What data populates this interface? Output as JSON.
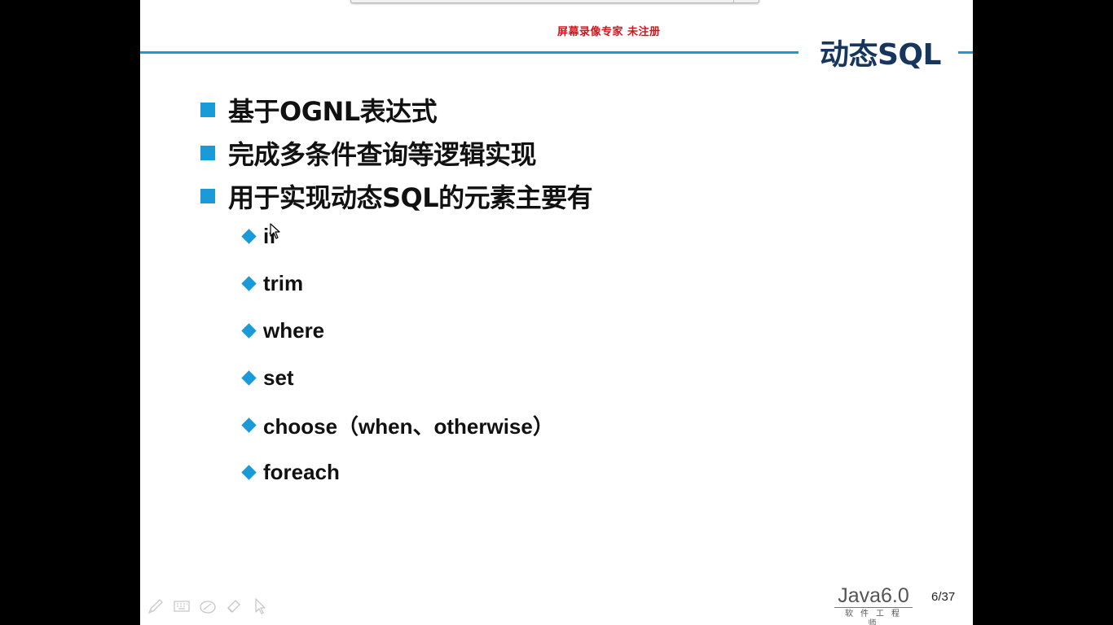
{
  "watermark": "屏幕录像专家  未注册",
  "slide": {
    "title": "动态SQL",
    "bullets": [
      "基于OGNL表达式",
      "完成多条件查询等逻辑实现",
      "用于实现动态SQL的元素主要有"
    ],
    "sub_items": [
      "if",
      "trim",
      "where",
      "set",
      "choose（when、otherwise）",
      "foreach"
    ]
  },
  "footer": {
    "logo_main": "Java6.0",
    "logo_sub": "软件工程师",
    "page_indicator": "6/37"
  },
  "toolbar": {
    "icons": [
      "pen-icon",
      "keyboard-icon",
      "eraser-icon",
      "highlighter-icon",
      "pointer-icon"
    ]
  },
  "colors": {
    "accent": "#1a9ad6",
    "title": "#17365d",
    "watermark": "#d4141c",
    "background": "#000000"
  }
}
